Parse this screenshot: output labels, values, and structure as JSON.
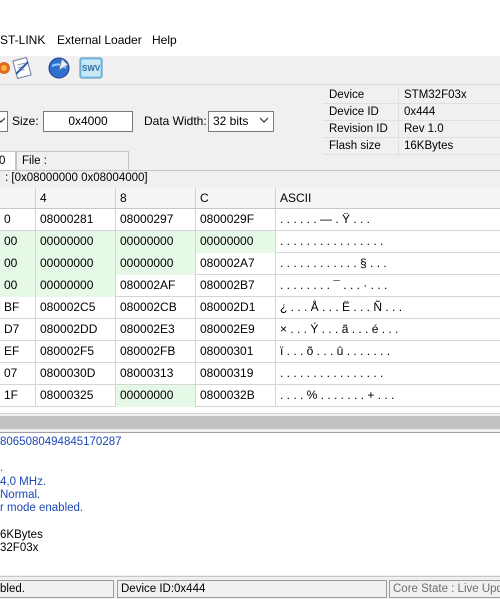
{
  "menu": {
    "items": [
      "ST-LINK",
      "External Loader",
      "Help"
    ]
  },
  "toolbar": {
    "icons": [
      "erase-icon",
      "verify-icon",
      "program-icon",
      "swv-icon"
    ],
    "swv_label": "SWV"
  },
  "memory": {
    "size_label": "Size:",
    "size_value": "0x4000",
    "data_width_label": "Data Width:",
    "data_width_value": "32 bits"
  },
  "device_info": {
    "rows": [
      {
        "key": "Device",
        "value": "STM32F03x"
      },
      {
        "key": "Device ID",
        "value": "0x444"
      },
      {
        "key": "Revision ID",
        "value": "Rev 1.0"
      },
      {
        "key": "Flash size",
        "value": "16KBytes"
      }
    ]
  },
  "tabs": {
    "device_tab": "0",
    "file_tab": "File : 8A_rssi_ch8.bin"
  },
  "range": ": [0x08000000 0x08004000]",
  "grid": {
    "headers": [
      "",
      "4",
      "8",
      "C",
      "ASCII"
    ],
    "rows": [
      {
        "c0": "0",
        "c4": "08000281",
        "c8": "08000297",
        "cC": "0800029F",
        "ascii": ". . .     . . . — . Ÿ . . .",
        "green": [
          false,
          false,
          false
        ]
      },
      {
        "c0": "00",
        "c4": "00000000",
        "c8": "00000000",
        "cC": "00000000",
        "ascii": ". . . . . . . . . . . . . . . .",
        "green": [
          true,
          true,
          true
        ]
      },
      {
        "c0": "00",
        "c4": "00000000",
        "c8": "00000000",
        "cC": "080002A7",
        "ascii": ". . . . . . . . . . . . § . . .",
        "green": [
          true,
          true,
          false
        ]
      },
      {
        "c0": "00",
        "c4": "00000000",
        "c8": "080002AF",
        "cC": "080002B7",
        "ascii": ". . . . . . . . ¯ . . . · . . .",
        "green": [
          true,
          false,
          false
        ]
      },
      {
        "c0": "BF",
        "c4": "080002C5",
        "c8": "080002CB",
        "cC": "080002D1",
        "ascii": "¿ . . . Å . . . Ë . . . Ñ . . .",
        "green": [
          false,
          false,
          false
        ]
      },
      {
        "c0": "D7",
        "c4": "080002DD",
        "c8": "080002E3",
        "cC": "080002E9",
        "ascii": "× . . . Ý . . . ã . . . é . . .",
        "green": [
          false,
          false,
          false
        ]
      },
      {
        "c0": "EF",
        "c4": "080002F5",
        "c8": "080002FB",
        "cC": "08000301",
        "ascii": "ï . . . õ . . . û . . . . . . .",
        "green": [
          false,
          false,
          false
        ]
      },
      {
        "c0": "07",
        "c4": "0800030D",
        "c8": "08000313",
        "cC": "08000319",
        "ascii": ". . . . . . . . . . . . . . . .",
        "green": [
          false,
          false,
          false
        ]
      },
      {
        "c0": "1F",
        "c4": "08000325",
        "c8": "00000000",
        "cC": "0800032B",
        "ascii": ". . . . % . . . . . . . + . . .",
        "green": [
          false,
          true,
          false
        ]
      }
    ]
  },
  "log": {
    "lines": [
      {
        "text": "8065080494845170287",
        "color": "blue"
      },
      {
        "text": "",
        "color": "blue"
      },
      {
        "text": ".",
        "color": "blue"
      },
      {
        "text": "4,0 MHz.",
        "color": "blue"
      },
      {
        "text": "Normal.",
        "color": "blue"
      },
      {
        "text": "r mode enabled.",
        "color": "blue"
      },
      {
        "text": "",
        "color": "black"
      },
      {
        "text": "6KBytes",
        "color": "black"
      },
      {
        "text": "32F03x",
        "color": "black"
      }
    ]
  },
  "status": {
    "left": "bled.",
    "middle": "Device ID:0x444",
    "right": "Core State : Live Upda"
  },
  "colors": {
    "log_blue": "#1c49b4",
    "cell_green": "#e6f8e6"
  }
}
